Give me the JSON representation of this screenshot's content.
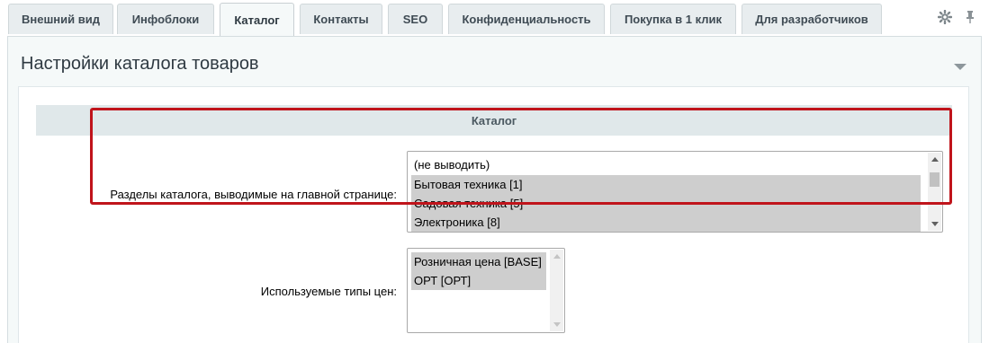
{
  "tabs": [
    {
      "label": "Внешний вид",
      "active": false
    },
    {
      "label": "Инфоблоки",
      "active": false
    },
    {
      "label": "Каталог",
      "active": true
    },
    {
      "label": "Контакты",
      "active": false
    },
    {
      "label": "SEO",
      "active": false
    },
    {
      "label": "Конфиденциальность",
      "active": false
    },
    {
      "label": "Покупка в 1 клик",
      "active": false
    },
    {
      "label": "Для разработчиков",
      "active": false
    }
  ],
  "toolbar": {
    "settings_icon": "gear-icon",
    "pin_icon": "pin-icon"
  },
  "panel": {
    "title": "Настройки каталога товаров",
    "collapse_icon": "chevron-down-icon"
  },
  "section": {
    "heading": "Каталог"
  },
  "fields": {
    "catalog_sections": {
      "label": "Разделы каталога, выводимые на главной странице:",
      "options": [
        {
          "text": "(не выводить)",
          "selected": false
        },
        {
          "text": "Бытовая техника [1]",
          "selected": true
        },
        {
          "text": "Садовая техника [5]",
          "selected": true
        },
        {
          "text": "Электроника [8]",
          "selected": true
        }
      ]
    },
    "price_types": {
      "label": "Используемые типы цен:",
      "options": [
        {
          "text": "Розничная цена [BASE]",
          "selected": true
        },
        {
          "text": "ОРТ [ОРТ]",
          "selected": true
        }
      ]
    }
  },
  "colors": {
    "highlight": "#c0141b",
    "selected_option": "#cecece"
  }
}
